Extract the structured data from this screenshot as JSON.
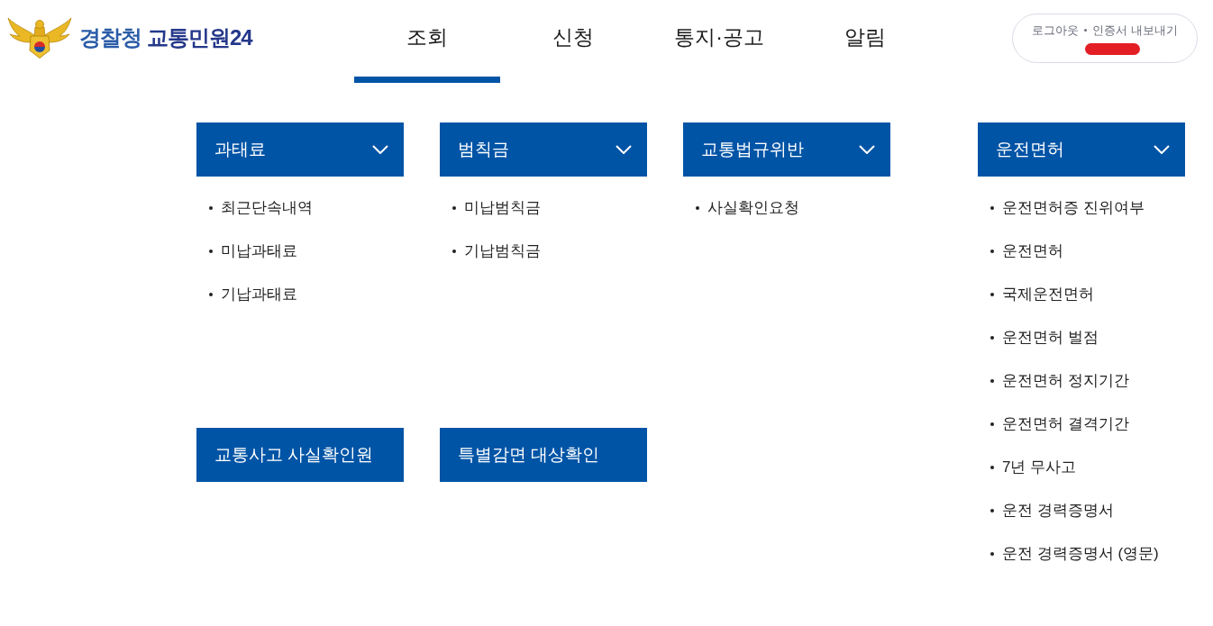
{
  "header": {
    "logo": {
      "agency": "경찰청",
      "service": "교통민원24"
    },
    "nav": [
      {
        "label": "조회",
        "selected": true
      },
      {
        "label": "신청",
        "selected": false
      },
      {
        "label": "통지·공고",
        "selected": false
      },
      {
        "label": "알림",
        "selected": false
      }
    ],
    "account": {
      "links": [
        "로그아웃",
        "인증서 내보내기"
      ]
    }
  },
  "menu": {
    "sections": [
      {
        "title": "과태료",
        "items": [
          "최근단속내역",
          "미납과태료",
          "기납과태료"
        ]
      },
      {
        "title": "범칙금",
        "items": [
          "미납범칙금",
          "기납범칙금"
        ]
      },
      {
        "title": "교통법규위반",
        "items": [
          "사실확인요청"
        ]
      },
      {
        "title": "운전면허",
        "items": [
          "운전면허증 진위여부",
          "운전면허",
          "국제운전면허",
          "운전면허 벌점",
          "운전면허 정지기간",
          "운전면허 결격기간",
          "7년 무사고",
          "운전 경력증명서",
          "운전 경력증명서 (영문)"
        ]
      }
    ],
    "shortcuts": [
      "교통사고 사실확인원",
      "특별감면 대상확인"
    ]
  }
}
